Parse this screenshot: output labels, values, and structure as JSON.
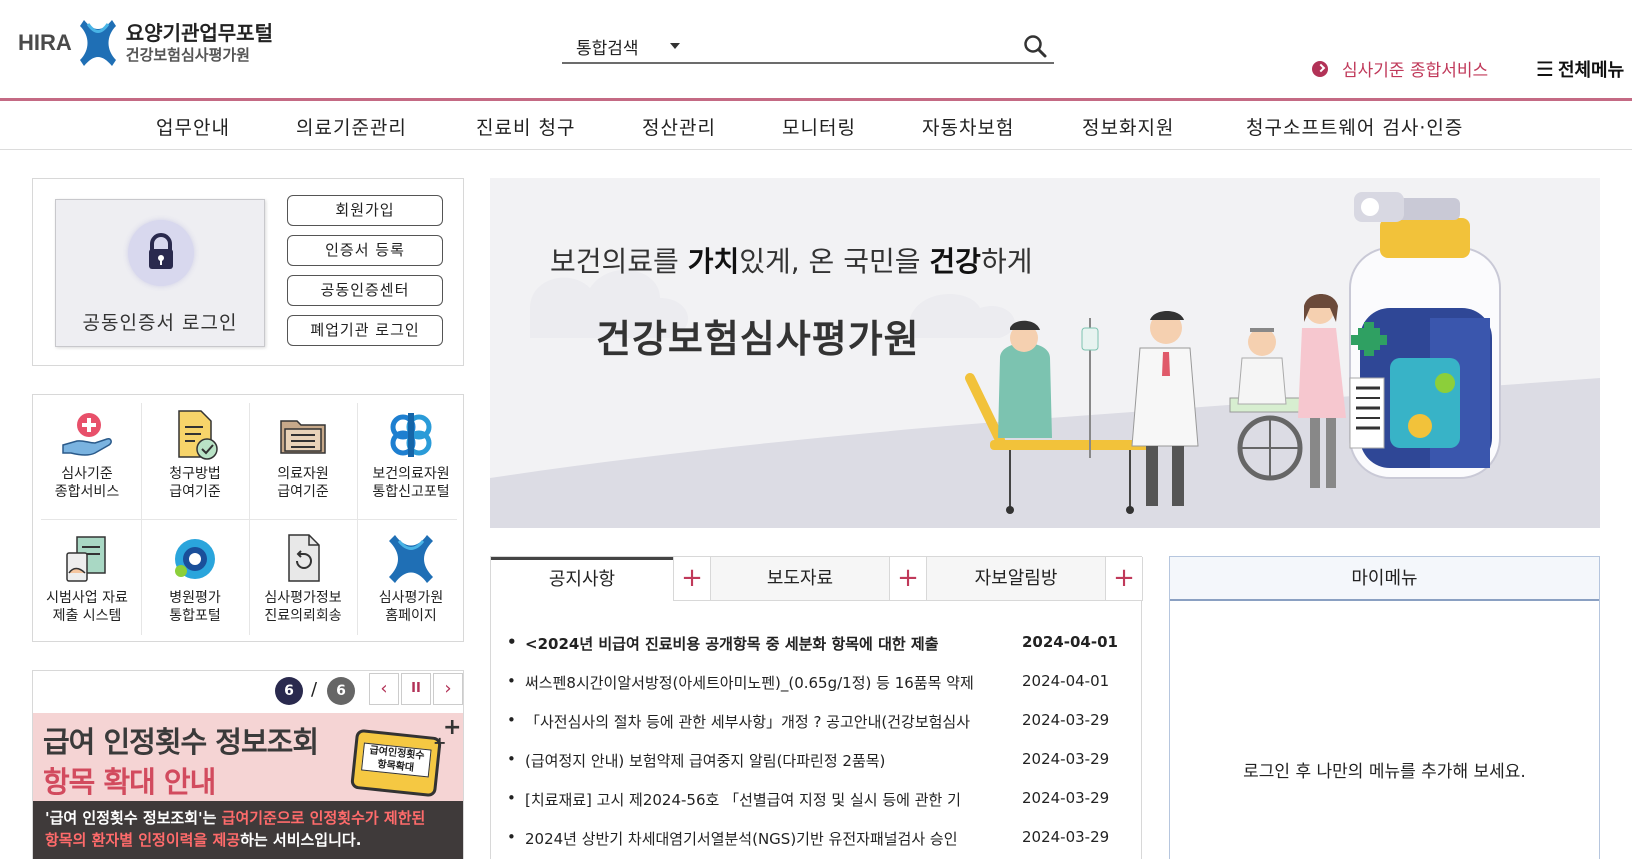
{
  "header": {
    "logo_brand": "HIRA",
    "logo_line1": "요양기관업무포털",
    "logo_line2": "건강보험심사평가원",
    "search_scope": "통합검색",
    "search_placeholder": "",
    "review_service_link": "심사기준 종합서비스",
    "all_menu": "전체메뉴"
  },
  "gnb": {
    "items": [
      "업무안내",
      "의료기준관리",
      "진료비 청구",
      "정산관리",
      "모니터링",
      "자동차보험",
      "정보화지원",
      "청구소프트웨어 검사·인증"
    ]
  },
  "login": {
    "cert_login": "공동인증서 로그인",
    "buttons": [
      "회원가입",
      "인증서 등록",
      "공동인증센터",
      "폐업기관 로그인"
    ]
  },
  "quick_links": [
    {
      "label": "심사기준\n종합서비스",
      "icon": "hand-heart-icon"
    },
    {
      "label": "청구방법\n급여기준",
      "icon": "document-check-icon"
    },
    {
      "label": "의료자원\n급여기준",
      "icon": "folder-icon"
    },
    {
      "label": "보건의료자원\n통합신고포털",
      "icon": "network-link-icon"
    },
    {
      "label": "시범사업 자료\n제출 시스템",
      "icon": "clipboard-tablet-icon"
    },
    {
      "label": "병원평가\n통합포털",
      "icon": "globe-ring-icon"
    },
    {
      "label": "심사평가정보\n진료의뢰회송",
      "icon": "document-return-icon"
    },
    {
      "label": "심사평가원\n홈페이지",
      "icon": "hira-x-icon"
    }
  ],
  "slider": {
    "current": "6",
    "separator": "/",
    "total": "6",
    "prev": "‹",
    "pause": "II",
    "next": "›",
    "title_line1": "급여 인정횟수 정보조회",
    "title_line2": "항목 확대 안내",
    "badge": "급여인정횟수 항목확대",
    "desc_part1": "'급여 인정횟수 정보조회'는 ",
    "desc_highlight1": "급여기준으로 인정횟수가 제한된",
    "desc_highlight2": "항목의 환자별 인정이력을 제공",
    "desc_part2": "하는 서비스입니다."
  },
  "hero": {
    "tag_part1": "보건의료를 ",
    "tag_bold1": "가치",
    "tag_part2": "있게, 온 국민을 ",
    "tag_bold2": "건강",
    "tag_part3": "하게",
    "title": "건강보험심사평가원"
  },
  "notice": {
    "tabs": [
      "공지사항",
      "보도자료",
      "자보알림방"
    ],
    "plus": "+",
    "bullet": "•",
    "rows": [
      {
        "title": "<2024년 비급여 진료비용 공개항목 중 세분화 항목에 대한 제출",
        "date": "2024-04-01"
      },
      {
        "title": "써스펜8시간이알서방정(아세트아미노펜)_(0.65g/1정) 등 16품목 약제",
        "date": "2024-04-01"
      },
      {
        "title": "「사전심사의 절차 등에 관한 세부사항」개정 ? 공고안내(건강보험심사",
        "date": "2024-03-29"
      },
      {
        "title": "(급여정지 안내) 보험약제 급여중지 알림(다파린정 2품목)",
        "date": "2024-03-29"
      },
      {
        "title": "[치료재료] 고시 제2024-56호 「선별급여 지정 및 실시 등에 관한 기",
        "date": "2024-03-29"
      },
      {
        "title": "2024년 상반기 차세대염기서열분석(NGS)기반 유전자패널검사 승인",
        "date": "2024-03-29"
      }
    ]
  },
  "my_menu": {
    "title": "마이메뉴",
    "message": "로그인 후 나만의 메뉴를 추가해 보세요."
  },
  "colors": {
    "accent": "#c0395a",
    "divider": "#c46a84",
    "navy": "#2a2a4e"
  }
}
